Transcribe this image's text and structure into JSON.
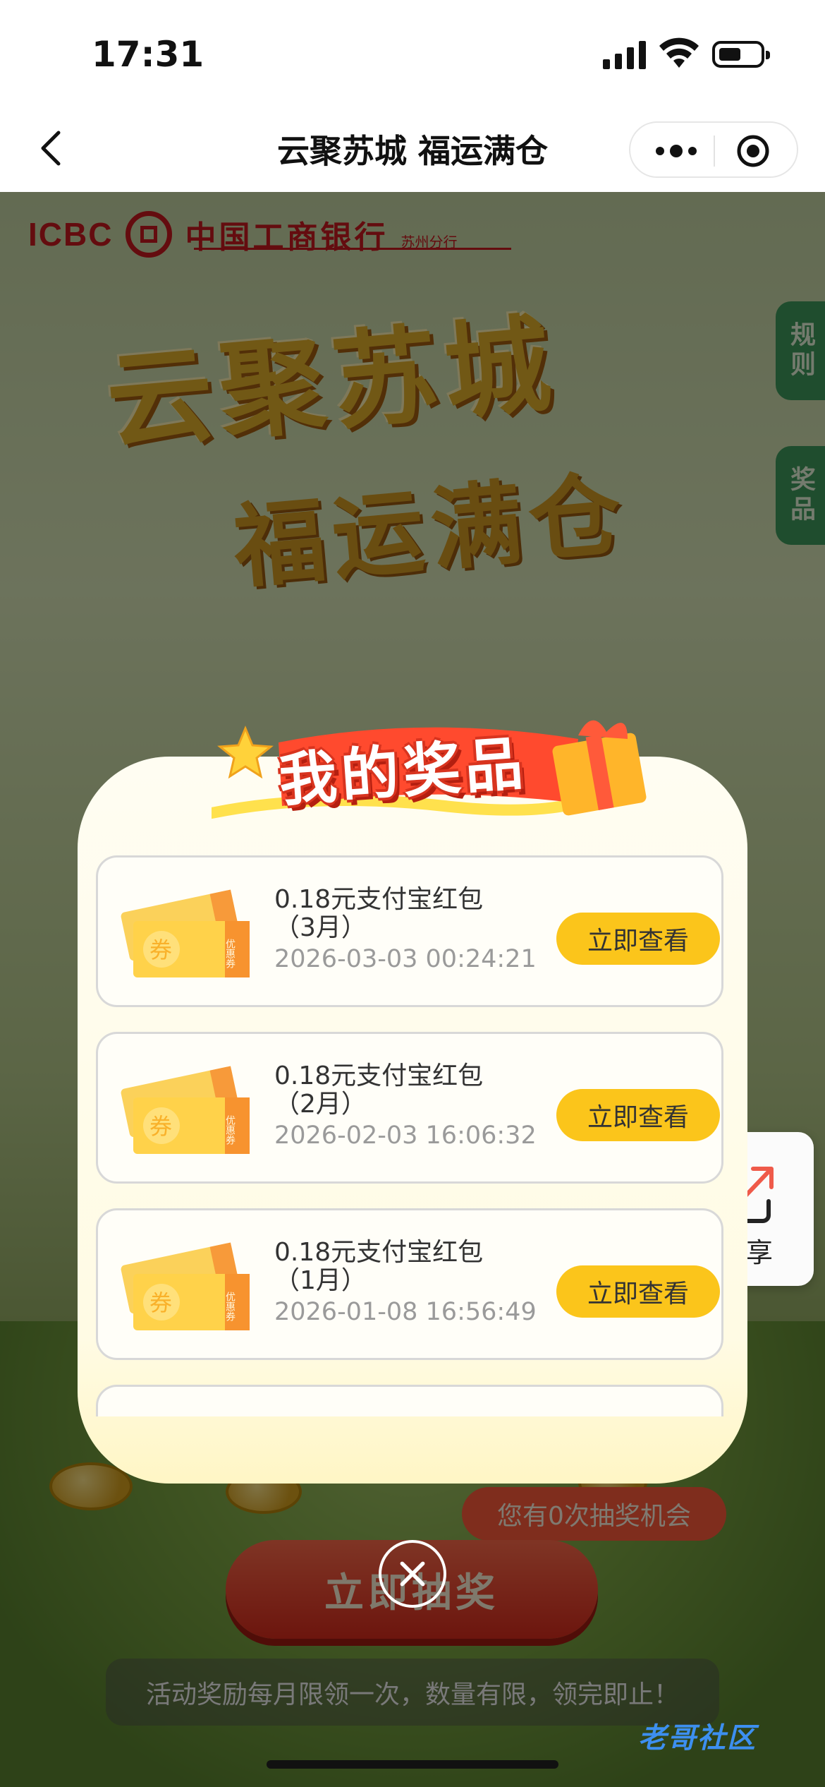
{
  "status_bar": {
    "time": "17:31"
  },
  "nav": {
    "title": "云聚苏城 福运满仓"
  },
  "bank": {
    "logo_text": "ICBC",
    "name": "中国工商银行",
    "branch": "苏州分行"
  },
  "hero": {
    "line1": "云聚苏城",
    "line2": "福运满仓"
  },
  "side_tabs": {
    "rules": "规则",
    "prizes": "奖品"
  },
  "modal": {
    "title": "我的奖品",
    "items": [
      {
        "name": "0.18元支付宝红包",
        "month": "（3月）",
        "time": "2026-03-03 00:24:21",
        "button": "立即查看"
      },
      {
        "name": "0.18元支付宝红包",
        "month": "（2月）",
        "time": "2026-02-03 16:06:32",
        "button": "立即查看"
      },
      {
        "name": "0.18元支付宝红包",
        "month": "（1月）",
        "time": "2026-01-08 16:56:49",
        "button": "立即查看"
      }
    ],
    "coupon_text": "券",
    "coupon_side": "优惠券"
  },
  "share": {
    "label": "分享"
  },
  "lottery": {
    "chances": "您有0次抽奖机会",
    "button": "立即抽奖"
  },
  "notice": "活动奖励每月限领一次，数量有限，领完即止！",
  "watermark": "老哥社区",
  "colors": {
    "accent_yellow": "#fbc51b",
    "icbc_red": "#c9181e",
    "draw_red": "#d92b1c"
  }
}
